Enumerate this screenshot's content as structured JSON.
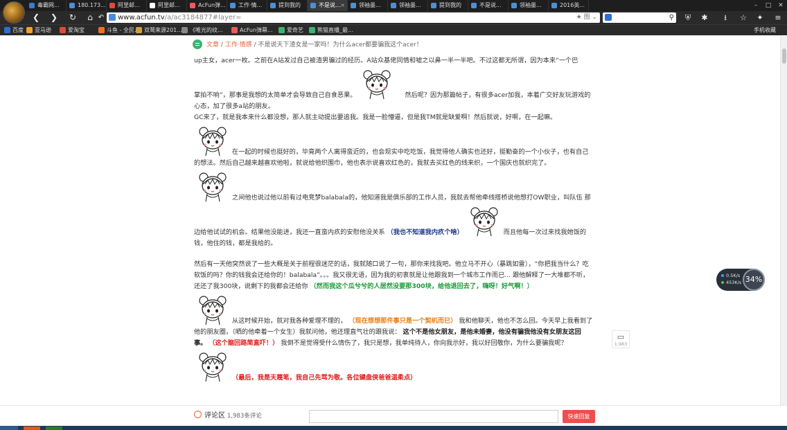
{
  "browser": {
    "tabs": [
      {
        "title": "毒霸网...",
        "color": "#3a7bd5",
        "active": false
      },
      {
        "title": "180.173...",
        "color": "#4a90d9",
        "active": false
      },
      {
        "title": "阿里邮...",
        "color": "#e04a3a",
        "active": false
      },
      {
        "title": "阿里邮...",
        "color": "#ffffff",
        "active": false
      },
      {
        "title": "AcFun弹...",
        "color": "#f05a5a",
        "active": false
      },
      {
        "title": "工作·情...",
        "color": "#4a90d9",
        "active": false
      },
      {
        "title": "提到我的",
        "color": "#4a90d9",
        "active": false
      },
      {
        "title": "不是说...",
        "color": "#4a90d9",
        "active": true
      },
      {
        "title": "领袖墨...",
        "color": "#4a90d9",
        "active": false
      },
      {
        "title": "领袖墨...",
        "color": "#4a90d9",
        "active": false
      },
      {
        "title": "提到我的",
        "color": "#4a90d9",
        "active": false
      },
      {
        "title": "不是说...",
        "color": "#4a90d9",
        "active": false
      },
      {
        "title": "领袖墨...",
        "color": "#4a90d9",
        "active": false
      },
      {
        "title": "2016英...",
        "color": "#4a90d9",
        "active": false
      }
    ],
    "window_controls": [
      "–",
      "□",
      "✕"
    ],
    "address": {
      "host": "www.acfun.tv",
      "path": "/a/ac3184877#layer="
    },
    "address_extra": "★ 图 ⌄",
    "search_placeholder": "",
    "bookmarks": [
      {
        "label": "百度",
        "color": "#2e6ed6"
      },
      {
        "label": "亚马逊",
        "color": "#f0a030"
      },
      {
        "label": "爱淘宝",
        "color": "#e04a3a"
      },
      {
        "label": "斗鱼 - 全民...",
        "color": "#f07020"
      },
      {
        "label": "双莺来源201...",
        "color": "#d0a040"
      },
      {
        "label": "《唯光的纹...",
        "color": "#888888"
      },
      {
        "label": "AcFun弹幕...",
        "color": "#f05a5a"
      },
      {
        "label": "爱奇艺",
        "color": "#3cb371"
      },
      {
        "label": "熊猫直播_最...",
        "color": "#3cb371"
      }
    ],
    "bookmark_right": "手机收藏",
    "icons": {
      "back": "❮",
      "forward": "❯",
      "refresh": "↻",
      "home": "⌂",
      "undo": "↶",
      "shield": "⛨",
      "puzzle": "✱",
      "download": "⭳",
      "star": "☆",
      "game": "✦",
      "menu": "≡",
      "search": "⚲"
    }
  },
  "breadcrumb": {
    "section": "文章",
    "category": "工作·情感",
    "separator": "/",
    "title": "不是说天下渣女是一家吗！为什么acer都要骗我这个acer！"
  },
  "article": {
    "p1a": "up主女，acer一枚。之前在A站发过自己被渣男骗过的经历。A站众基佬同情和嘘之以鼻一半一半吧。不过这都无所谓，因为本来“一个巴",
    "p1b": "掌拍不响”，那事是我想的太简单才会导致自己自食恶果。",
    "p1c": "然后呢？因为那篇帖子，有很多acer加我，本着广交好友玩游戏的心态，加了很多a站的朋友。",
    "p2": "GC来了，就是我本来什么都没想，那人就主动提出要追我。我是一脸懵逼，但是我TM就是缺爱啊！然后就说，好啊，在一起嘛。",
    "p3": "在一起的时候也挺好的，毕竟两个人离得蛮近的，也会现实中吃吃饭，我觉得他人确实也还好，挺勤奋的一个小伙子，也有自己的想法。然后自己越来越喜欢他啦，就说给他织围巾，他也表示说喜欢红色的，我就去买红色的线来织，一个国庆也就织完了。",
    "p4a": "之间他也说过他以前有过电竞梦balabala的，他知道我是俱乐部的工作人员，我就去帮他牵线搭桥说他想打OW职业，叫队伍",
    "p4b": "那边给他试试的机会。结果他没能进，我还一直蛮内疚的安慰他没关系",
    "p4b_blue": "（我也不知道我内疚个啥）",
    "p4c": "而且他每一次过来找我她饭的钱，他住的钱，都是我给的。",
    "p5a": "然后有一天他突然说了一些大概是关于前程很迷茫的话，我就随口说了一句，那你来找我吧。他立马不开心（暴跳如雷），“你把我当什么？吃软饭的吗？你的钱我会还给你的！balabala”。。。我又很无语，因为我的初衷就是让他跟我到一个城市工作而已... 跟他解释了一大堆都不听，还还了我300块，说剩下的我都会还给你",
    "p5_green": "（然而我这个瓜兮兮的人居然没要那300块，给他退回去了，嗨呀！好气啊！）",
    "p6a": "从这时候开始，就对我各种爱理不理的，",
    "p6_orange": "（现在想想那件事只是一个契机而已）",
    "p6b": "我和他聊天，他也不怎么回。今天早上我看到了他的朋友圈，（晒的他牵着一个女生）我就问他，他还理直气壮的跟我说：",
    "p6_bold": "这个不是他女朋友，是他未婚妻，他没有骗我他没有女朋友这回事。",
    "p6_red": "（这个脑回路简直吓！）",
    "p6c": "我倒不是觉得受什么情伤了，我只是想，我单纯待人，你向我示好，我以好回敬你，为什么要骗我呢？",
    "p7_red": "（最后，我是天蔑笔，我自己先骂为敬。各位键盘侠爸爸温柔点）"
  },
  "side": {
    "comment_count_float": "1,983",
    "speed_up": "0.5K/s",
    "speed_down": "453K/s",
    "percent": "34%"
  },
  "comment_bar": {
    "label": "评论区",
    "count": "1,983条评论",
    "input_placeholder": "",
    "reply_button": "快速回复"
  }
}
